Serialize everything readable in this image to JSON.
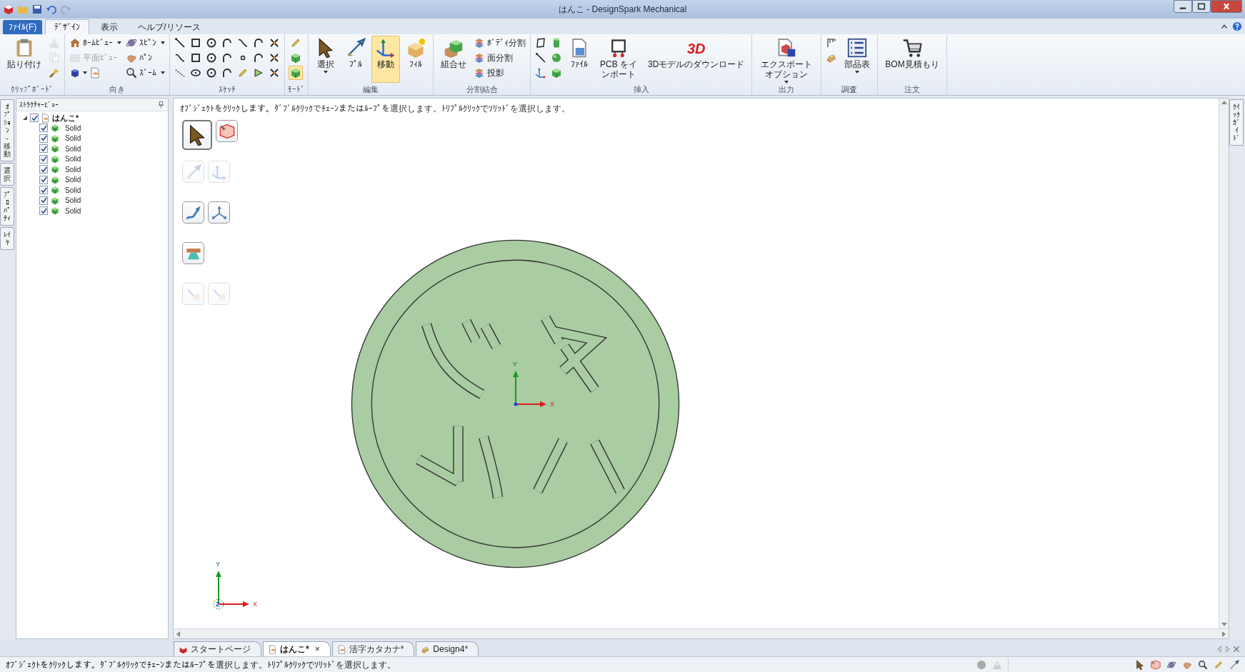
{
  "window": {
    "title": "はんこ - DesignSpark Mechanical"
  },
  "ribbon": {
    "tabs": [
      {
        "label": "ﾌｧｲﾙ(F)",
        "kind": "file",
        "selected": false
      },
      {
        "label": "ﾃﾞｻﾞｲﾝ",
        "kind": "tab",
        "selected": true
      },
      {
        "label": "表示",
        "kind": "tab",
        "selected": false
      },
      {
        "label": "ヘルプ/リソース",
        "kind": "tab",
        "selected": false
      }
    ],
    "groups": [
      {
        "title": "ｸﾘｯﾌﾟﾎﾞｰﾄﾞ",
        "items": [
          {
            "kind": "large",
            "label": "貼り付け",
            "disabled": false
          },
          {
            "kind": "icon",
            "disabled": true
          },
          {
            "kind": "icon",
            "disabled": true
          },
          {
            "kind": "icon",
            "disabled": false
          }
        ]
      },
      {
        "title": "向き",
        "items": [
          {
            "kind": "small",
            "label": "ﾎｰﾑﾋﾞｭｰ",
            "dropdown": true,
            "disabled": false
          },
          {
            "kind": "small",
            "label": "平面ﾋﾞｭｰ",
            "dropdown": false,
            "disabled": true
          },
          {
            "kind": "dropicon",
            "disabled": false
          },
          {
            "kind": "small",
            "label": "ｽﾋﾟﾝ",
            "dropdown": true,
            "disabled": false
          },
          {
            "kind": "small",
            "label": "ﾊﾟﾝ",
            "dropdown": false,
            "disabled": false
          },
          {
            "kind": "small",
            "label": "ｽﾞｰﾑ",
            "dropdown": true,
            "disabled": false
          }
        ]
      },
      {
        "title": "ｽｹｯﾁ",
        "items": [
          {
            "kind": "icon"
          },
          {
            "kind": "icon"
          },
          {
            "kind": "icon"
          },
          {
            "kind": "icon"
          },
          {
            "kind": "icon"
          },
          {
            "kind": "icon"
          },
          {
            "kind": "icon"
          },
          {
            "kind": "icon"
          },
          {
            "kind": "icon"
          },
          {
            "kind": "icon"
          },
          {
            "kind": "icon"
          },
          {
            "kind": "icon"
          },
          {
            "kind": "icon"
          },
          {
            "kind": "icon"
          },
          {
            "kind": "icon"
          },
          {
            "kind": "icon"
          },
          {
            "kind": "icon"
          },
          {
            "kind": "icon"
          },
          {
            "kind": "icon"
          },
          {
            "kind": "icon"
          },
          {
            "kind": "icon"
          }
        ]
      },
      {
        "title": "ﾓｰﾄﾞ",
        "items": [
          {
            "kind": "icon",
            "selected": false
          },
          {
            "kind": "icon",
            "selected": false
          },
          {
            "kind": "icon",
            "selected": true
          }
        ]
      },
      {
        "title": "編集",
        "items": [
          {
            "kind": "large",
            "label": "選択",
            "dropdown": true,
            "selected": false
          },
          {
            "kind": "large",
            "label": "ﾌﾟﾙ",
            "dropdown": false,
            "selected": false
          },
          {
            "kind": "large",
            "label": "移動",
            "dropdown": false,
            "selected": true
          },
          {
            "kind": "large",
            "label": "ﾌｨﾙ",
            "dropdown": false,
            "selected": false
          }
        ]
      },
      {
        "title": "分割結合",
        "items": [
          {
            "kind": "large",
            "label": "組合せ"
          },
          {
            "kind": "small",
            "label": "ﾎﾞﾃﾞｨ分割"
          },
          {
            "kind": "small",
            "label": "面分割"
          },
          {
            "kind": "small",
            "label": "投影"
          }
        ]
      },
      {
        "title": "挿入",
        "items": [
          {
            "kind": "icon"
          },
          {
            "kind": "icon"
          },
          {
            "kind": "icon"
          },
          {
            "kind": "icon"
          },
          {
            "kind": "icon"
          },
          {
            "kind": "icon"
          },
          {
            "kind": "large",
            "label": "ﾌｧｲﾙ"
          },
          {
            "kind": "large",
            "label": "PCB をインポート"
          },
          {
            "kind": "large",
            "label": "3Dモデルのダウンロード",
            "badge": "3D"
          }
        ]
      },
      {
        "title": "出力",
        "items": [
          {
            "kind": "large",
            "label": "エクスポートオプション",
            "dropdown": true
          }
        ]
      },
      {
        "title": "調査",
        "items": [
          {
            "kind": "icon"
          },
          {
            "kind": "icon"
          },
          {
            "kind": "large",
            "label": "部品表",
            "dropdown": true
          }
        ]
      },
      {
        "title": "注文",
        "items": [
          {
            "kind": "large",
            "label": "BOM見積もり"
          }
        ]
      }
    ]
  },
  "side_tabs": [
    {
      "label": "ｵﾌﾟｼｮﾝ - 移動"
    },
    {
      "label": "選択"
    },
    {
      "label": "ﾌﾟﾛﾊﾟﾃｨ"
    },
    {
      "label": "ﾚｲﾔ"
    }
  ],
  "structure_panel": {
    "title": "ｽﾄﾗｸﾁｬｰﾋﾞｭｰ",
    "tree": [
      {
        "label": "はんこ*",
        "checked": true,
        "expanded": true,
        "children": [
          {
            "label": "Solid",
            "checked": true
          },
          {
            "label": "Solid",
            "checked": true
          },
          {
            "label": "Solid",
            "checked": true
          },
          {
            "label": "Solid",
            "checked": true
          },
          {
            "label": "Solid",
            "checked": true
          },
          {
            "label": "Solid",
            "checked": true
          },
          {
            "label": "Solid",
            "checked": true
          },
          {
            "label": "Solid",
            "checked": true
          },
          {
            "label": "Solid",
            "checked": true
          }
        ]
      }
    ]
  },
  "canvas": {
    "hint": "ｵﾌﾞｼﾞｪｸﾄをｸﾘｯｸします。ﾀﾞﾌﾞﾙｸﾘｯｸでﾁｪｰﾝまたはﾙｰﾌﾟを選択します。ﾄﾘﾌﾟﾙｸﾘｯｸでｿﾘｯﾄﾞを選択します。",
    "tool_palette": [
      [
        {
          "selected": true,
          "disabled": false
        },
        {
          "selected": false,
          "disabled": false
        }
      ],
      [
        {
          "selected": false,
          "disabled": true
        },
        {
          "selected": false,
          "disabled": true
        }
      ],
      [
        {
          "selected": false,
          "disabled": false
        },
        {
          "selected": false,
          "disabled": false
        }
      ],
      [
        {
          "selected": false,
          "disabled": false
        }
      ],
      [
        {
          "selected": false,
          "disabled": true
        },
        {
          "selected": false,
          "disabled": true
        }
      ]
    ],
    "model_axes": {
      "x": "X",
      "y": "Y"
    },
    "view_triad": {
      "x": "X",
      "y": "Y",
      "z": "Z"
    }
  },
  "right_side_tabs": [
    {
      "label": "ｸｲｯｸｶﾞｲﾄﾞ"
    }
  ],
  "document_tabs": [
    {
      "label": "スタートページ",
      "selected": false
    },
    {
      "label": "はんこ*",
      "selected": true,
      "close": "×"
    },
    {
      "label": "活字カタカナ*",
      "selected": false
    },
    {
      "label": "Design4*",
      "selected": false
    }
  ],
  "status_bar": {
    "text": "ｵﾌﾞｼﾞｪｸﾄをｸﾘｯｸします。ﾀﾞﾌﾞﾙｸﾘｯｸでﾁｪｰﾝまたはﾙｰﾌﾟを選択します。ﾄﾘﾌﾟﾙｸﾘｯｸでｿﾘｯﾄﾞを選択します。"
  }
}
